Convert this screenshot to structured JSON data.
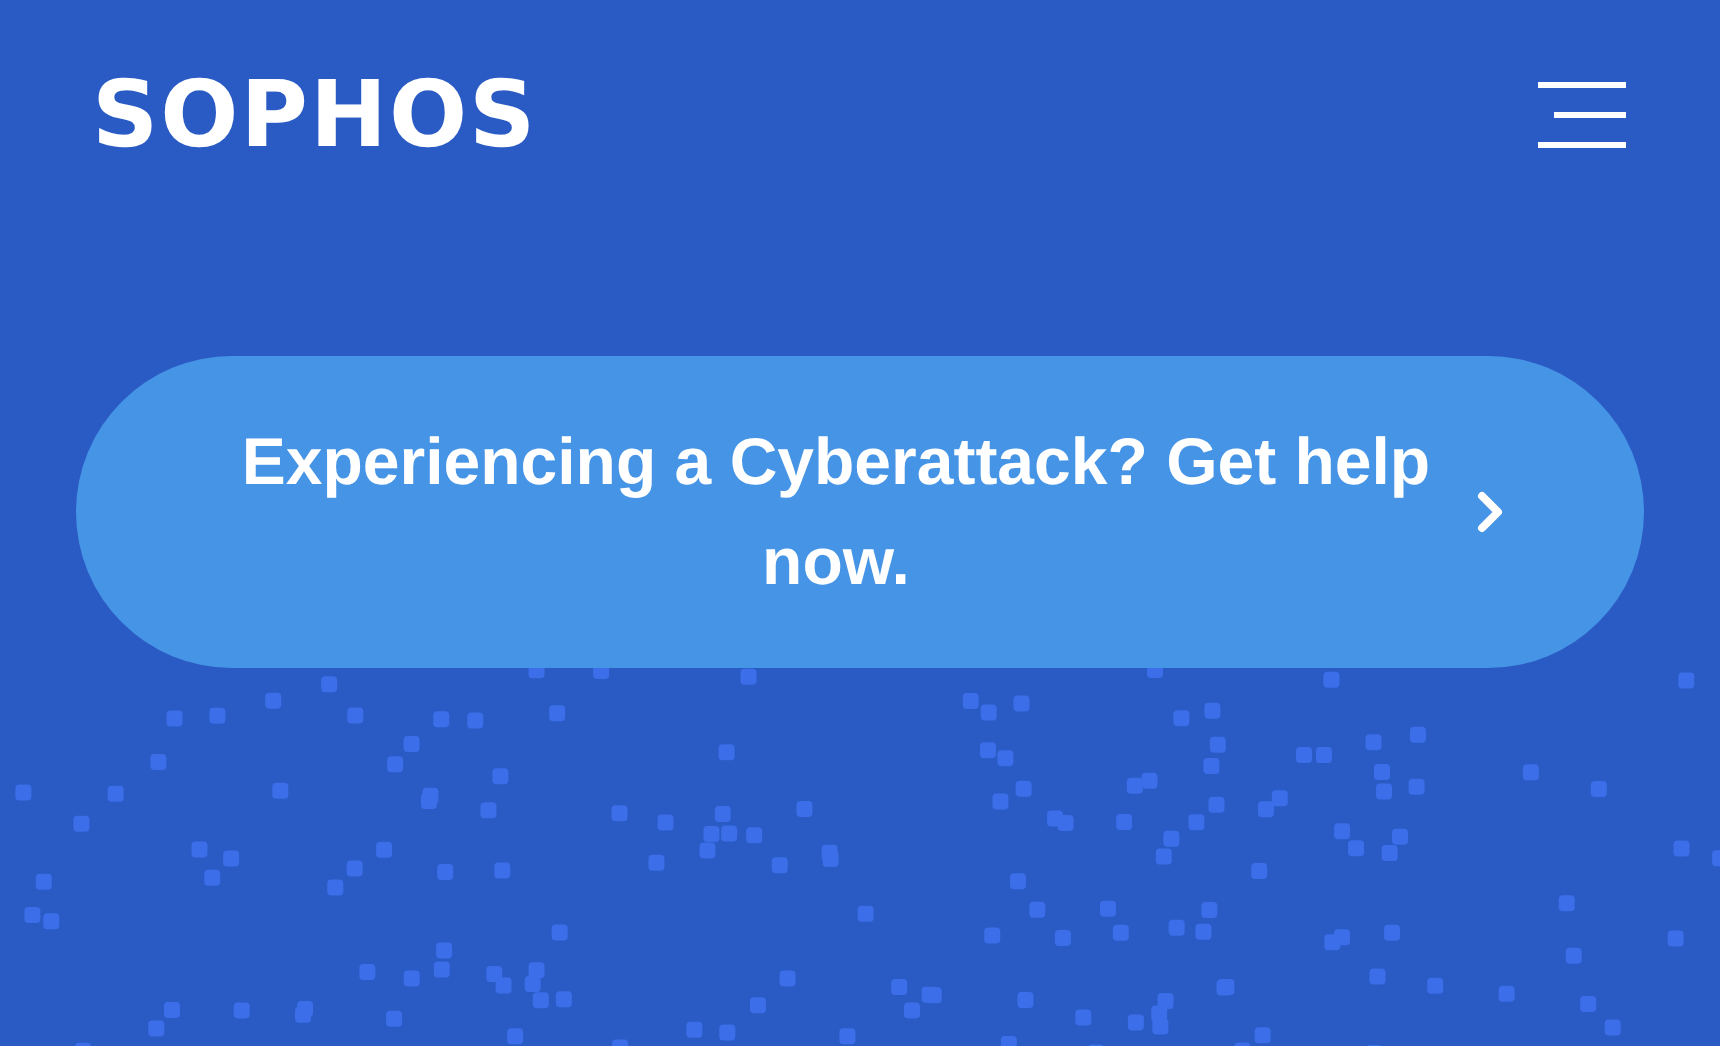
{
  "header": {
    "logo": "SOPHOS"
  },
  "banner": {
    "text": "Experiencing a Cyberattack? Get help now."
  }
}
